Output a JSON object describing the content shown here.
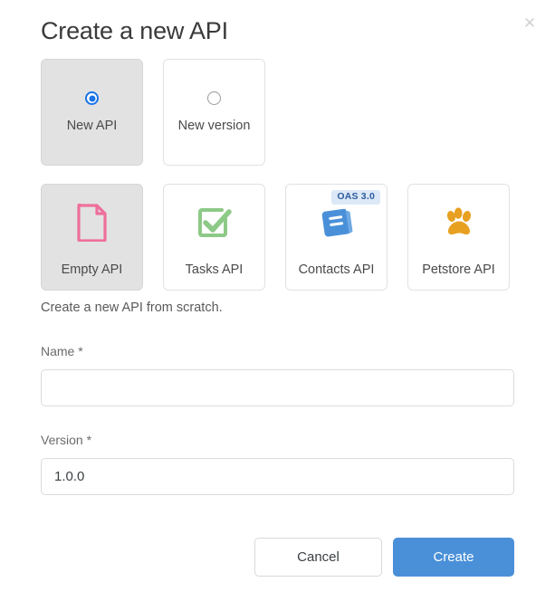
{
  "dialog": {
    "title": "Create a new API",
    "close_icon": "close-icon",
    "close_label": "✕"
  },
  "modes": {
    "selected": "new-api",
    "options": [
      {
        "id": "new-api",
        "label": "New API",
        "selected": true
      },
      {
        "id": "new-version",
        "label": "New version",
        "selected": false
      }
    ]
  },
  "templates": {
    "selected": "empty-api",
    "options": [
      {
        "id": "empty-api",
        "label": "Empty API",
        "icon": "document-icon",
        "selected": true,
        "badge": ""
      },
      {
        "id": "tasks-api",
        "label": "Tasks API",
        "icon": "checkbox-check-icon",
        "selected": false,
        "badge": ""
      },
      {
        "id": "contacts-api",
        "label": "Contacts API",
        "icon": "address-book-icon",
        "selected": false,
        "badge": "OAS 3.0"
      },
      {
        "id": "petstore-api",
        "label": "Petstore API",
        "icon": "paw-icon",
        "selected": false,
        "badge": ""
      }
    ]
  },
  "description": "Create a new API from scratch.",
  "form": {
    "name": {
      "label": "Name *",
      "value": "",
      "placeholder": ""
    },
    "version": {
      "label": "Version *",
      "value": "1.0.0",
      "placeholder": ""
    }
  },
  "footer": {
    "cancel_label": "Cancel",
    "create_label": "Create"
  },
  "colors": {
    "accent_blue": "#4a90d9",
    "radio_blue": "#1a73e8",
    "selected_card_bg": "#e2e2e2",
    "badge_bg": "#dce8f7",
    "badge_text": "#2d5c9e",
    "empty_icon_pink": "#ee6f9c",
    "tasks_icon_green": "#8dc987",
    "contacts_icon_blue": "#4a90d9",
    "petstore_icon_orange": "#e8a020"
  }
}
